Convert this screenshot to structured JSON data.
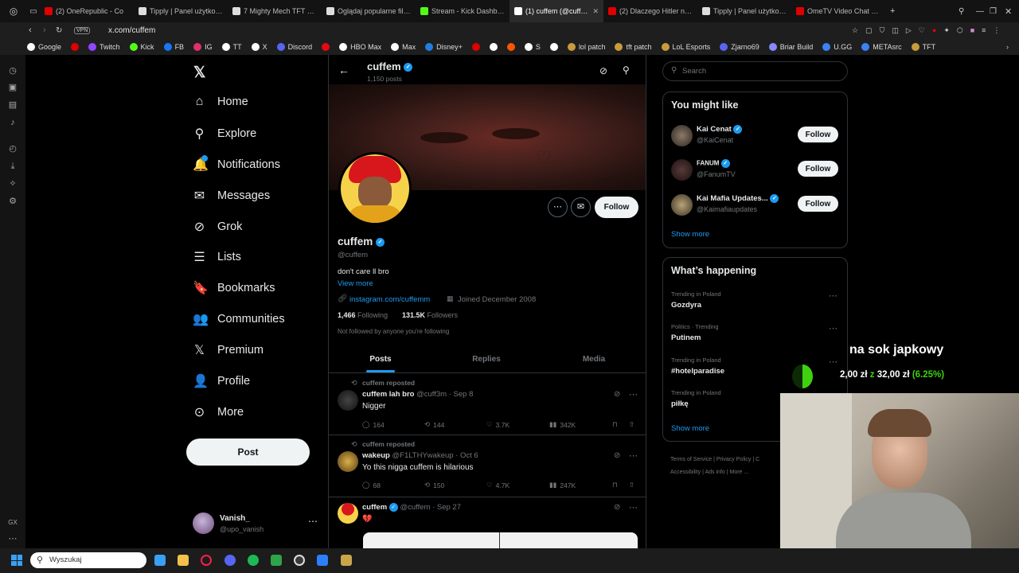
{
  "browser": {
    "tabs": [
      {
        "label": "(2) OneRepublic - Co",
        "color": "#e10000"
      },
      {
        "label": "Tipply | Panel użytkown",
        "color": "#dddddd"
      },
      {
        "label": "7 Mighty Mech TFT Com",
        "color": "#dddddd"
      },
      {
        "label": "Oglądaj popularne filmy",
        "color": "#dddddd"
      },
      {
        "label": "Stream - Kick Dashboa",
        "color": "#53fc18"
      },
      {
        "label": "(1) cuffem (@cuffem",
        "color": "#ffffff"
      },
      {
        "label": "(2) Dlaczego Hitler nien",
        "color": "#e10000"
      },
      {
        "label": "Tipply | Panel użytkown",
        "color": "#dddddd"
      },
      {
        "label": "OmeTV Video Chat Rule",
        "color": "#e10000"
      }
    ],
    "vpn": "VPN",
    "url": "x.com/cuffem",
    "bookmarks": [
      {
        "label": "Google",
        "color": "#ffffff"
      },
      {
        "label": "",
        "color": "#e10000"
      },
      {
        "label": "Twitch",
        "color": "#9146ff"
      },
      {
        "label": "Kick",
        "color": "#53fc18"
      },
      {
        "label": "FB",
        "color": "#1877f2"
      },
      {
        "label": "IG",
        "color": "#e1306c"
      },
      {
        "label": "TT",
        "color": "#ffffff"
      },
      {
        "label": "X",
        "color": "#ffffff"
      },
      {
        "label": "Discord",
        "color": "#5865f2"
      },
      {
        "label": "",
        "color": "#e50914"
      },
      {
        "label": "HBO Max",
        "color": "#ffffff"
      },
      {
        "label": "Max",
        "color": "#ffffff"
      },
      {
        "label": "Disney+",
        "color": "#1f80e0"
      },
      {
        "label": "",
        "color": "#e10000"
      },
      {
        "label": "",
        "color": "#ffffff"
      },
      {
        "label": "",
        "color": "#ff5500"
      },
      {
        "label": "S",
        "color": "#ffffff"
      },
      {
        "label": "",
        "color": "#ffffff"
      },
      {
        "label": "lol patch",
        "color": "#c89b3c"
      },
      {
        "label": "tft patch",
        "color": "#c89b3c"
      },
      {
        "label": "LoL Esports",
        "color": "#c89b3c"
      },
      {
        "label": "Zjarno69",
        "color": "#5865f2"
      },
      {
        "label": "Briar Build",
        "color": "#8888ff"
      },
      {
        "label": "U.GG",
        "color": "#3b82f6"
      },
      {
        "label": "METAsrc",
        "color": "#3b82f6"
      },
      {
        "label": "TFT",
        "color": "#c89b3c"
      }
    ]
  },
  "nav": {
    "items": [
      {
        "label": "Home",
        "icon": "home-icon",
        "glyph": "⌂"
      },
      {
        "label": "Explore",
        "icon": "search-icon",
        "glyph": "⚲"
      },
      {
        "label": "Notifications",
        "icon": "bell-icon",
        "glyph": "🔔"
      },
      {
        "label": "Messages",
        "icon": "mail-icon",
        "glyph": "✉"
      },
      {
        "label": "Grok",
        "icon": "grok-icon",
        "glyph": "⊘"
      },
      {
        "label": "Lists",
        "icon": "list-icon",
        "glyph": "☰"
      },
      {
        "label": "Bookmarks",
        "icon": "bookmark-icon",
        "glyph": "🔖"
      },
      {
        "label": "Communities",
        "icon": "communities-icon",
        "glyph": "👥"
      },
      {
        "label": "Premium",
        "icon": "x-logo-icon",
        "glyph": "𝕏"
      },
      {
        "label": "Profile",
        "icon": "person-icon",
        "glyph": "👤"
      },
      {
        "label": "More",
        "icon": "more-circle-icon",
        "glyph": "⊙"
      }
    ],
    "post_label": "Post",
    "account": {
      "name": "Vanish_",
      "handle": "@upo_vanish"
    }
  },
  "profile": {
    "header_name": "cuffem",
    "posts_count": "1,150 posts",
    "follow_label": "Follow",
    "name": "cuffem",
    "handle": "@cuffem",
    "bio": "don't care ll bro",
    "view_more": "View more",
    "website": "instagram.com/cuffemm",
    "joined": "Joined December 2008",
    "following_count": "1,466",
    "following_label": "Following",
    "followers_count": "131.5K",
    "followers_label": "Followers",
    "not_followed": "Not followed by anyone you're following",
    "tabs": [
      "Posts",
      "Replies",
      "Media"
    ]
  },
  "posts": [
    {
      "repost": "cuffem reposted",
      "name": "cuffem lah bro",
      "handle": "@cuff3m",
      "date": "Sep 8",
      "text": "Nigger",
      "replies": "164",
      "reposts": "144",
      "likes": "3.7K",
      "views": "342K"
    },
    {
      "repost": "cuffem reposted",
      "name": "wakeup",
      "handle": "@F1LTHYwakeup",
      "date": "Oct 6",
      "text": "Yo this nigga cuffem is hilarious",
      "replies": "68",
      "reposts": "150",
      "likes": "4.7K",
      "views": "247K"
    },
    {
      "name": "cuffem",
      "handle": "@cuffem",
      "date": "Sep 27",
      "text": "💔"
    }
  ],
  "right": {
    "search_placeholder": "Search",
    "might_like_title": "You might like",
    "suggestions": [
      {
        "name": "Kai Cenat",
        "handle": "@KaiCenat"
      },
      {
        "name": "FANUM",
        "handle": "@FanumTV"
      },
      {
        "name": "Kai Mafia Updates...",
        "handle": "@Kaimafiaupdates"
      }
    ],
    "follow_label": "Follow",
    "show_more": "Show more",
    "happening_title": "What’s happening",
    "trends": [
      {
        "context": "Trending in Poland",
        "topic": "Gozdyra"
      },
      {
        "context": "Politics · Trending",
        "topic": "Putinem"
      },
      {
        "context": "Trending in Poland",
        "topic": "#hotelparadise"
      },
      {
        "context": "Trending in Poland",
        "topic": "piłkę"
      }
    ],
    "footer": [
      "Terms of Service",
      "Privacy Policy",
      "C",
      "Accessibility",
      "Ads info",
      "More ..."
    ]
  },
  "overlay": {
    "goal_title": "na sok japkowy",
    "goal_current": "2,00 zł",
    "goal_sep": "z",
    "goal_target": "32,00 zł",
    "goal_percent": "(6.25%)"
  },
  "taskbar": {
    "search_placeholder": "Wyszukaj"
  }
}
